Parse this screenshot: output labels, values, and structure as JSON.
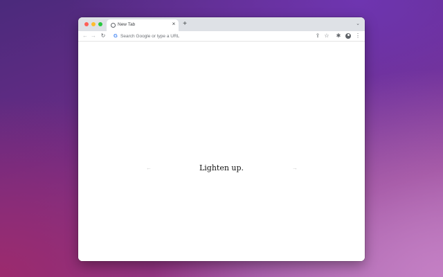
{
  "browser": {
    "tab": {
      "title": "New Tab",
      "favicon": "globe-icon",
      "close_glyph": "×"
    },
    "new_tab_glyph": "+",
    "tab_search_glyph": "⌄",
    "toolbar": {
      "back_glyph": "←",
      "forward_glyph": "→",
      "reload_glyph": "↻",
      "share_glyph": "⇪",
      "star_glyph": "☆",
      "extensions_glyph": "✱",
      "menu_glyph": "⋮"
    },
    "omnibox": {
      "google_glyph": "G",
      "placeholder": "Search Google or type a URL",
      "value": ""
    }
  },
  "page": {
    "quote": "Lighten up.",
    "prev_glyph": "←",
    "next_glyph": "→",
    "corner_glyph": "⋯"
  },
  "colors": {
    "traffic_close": "#ff5f57",
    "traffic_minimize": "#febc2e",
    "traffic_maximize": "#28c840",
    "tabstrip": "#dee1e6",
    "google_blue": "#4285f4"
  }
}
